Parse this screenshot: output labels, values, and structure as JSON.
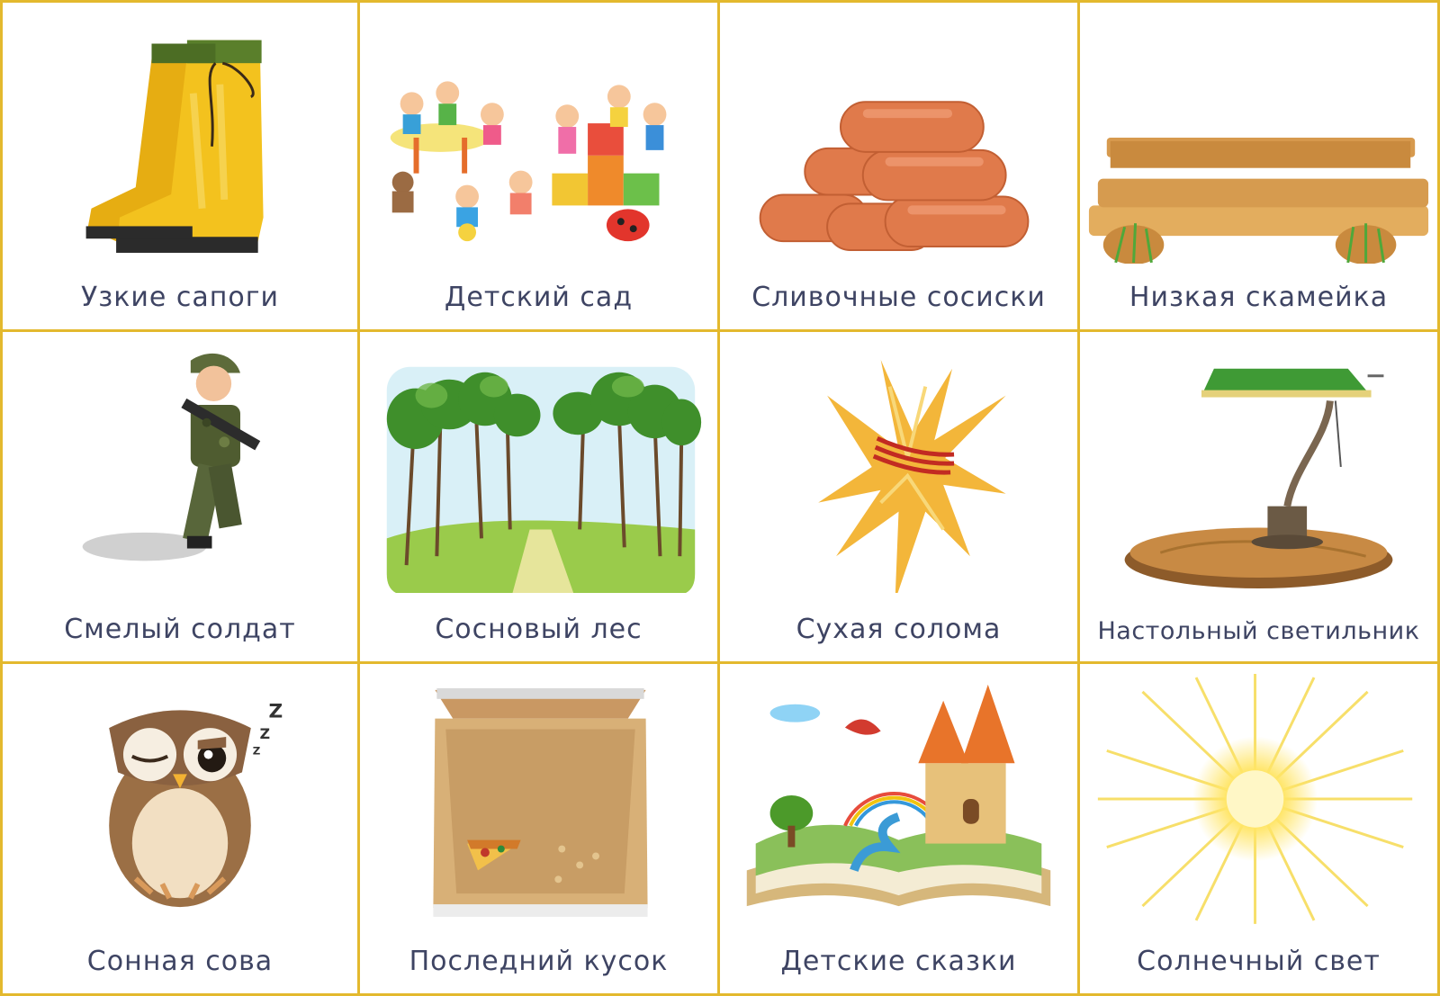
{
  "cards": [
    {
      "caption": "Узкие сапоги",
      "icon": "rubber-boots-icon"
    },
    {
      "caption": "Детский сад",
      "icon": "kindergarten-icon"
    },
    {
      "caption": "Сливочные сосиски",
      "icon": "sausages-icon"
    },
    {
      "caption": "Низкая скамейка",
      "icon": "bench-icon"
    },
    {
      "caption": "Смелый солдат",
      "icon": "soldier-icon"
    },
    {
      "caption": "Сосновый лес",
      "icon": "pine-forest-icon"
    },
    {
      "caption": "Сухая солома",
      "icon": "straw-icon"
    },
    {
      "caption": "Настольный светильник",
      "icon": "desk-lamp-icon"
    },
    {
      "caption": "Сонная сова",
      "icon": "owl-icon"
    },
    {
      "caption": "Последний кусок",
      "icon": "pizza-box-icon"
    },
    {
      "caption": "Детские сказки",
      "icon": "fairy-tale-book-icon"
    },
    {
      "caption": "Солнечный свет",
      "icon": "sunlight-icon"
    }
  ],
  "colors": {
    "border": "#e3b92e",
    "caption": "#3e4463"
  }
}
